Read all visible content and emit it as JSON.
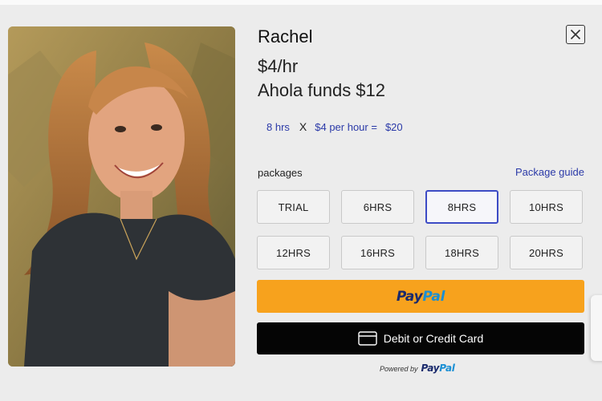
{
  "profile": {
    "name": "Rachel",
    "rate": "$4/hr",
    "funds": "Ahola funds $12"
  },
  "calculation": {
    "hours": "8 hrs",
    "multiply": "X",
    "per_hour": "$4 per hour =",
    "total": "$20"
  },
  "packages": {
    "label": "packages",
    "guide_link": "Package guide",
    "items": [
      {
        "label": "TRIAL",
        "selected": false
      },
      {
        "label": "6HRS",
        "selected": false
      },
      {
        "label": "8HRS",
        "selected": true
      },
      {
        "label": "10HRS",
        "selected": false
      },
      {
        "label": "12HRS",
        "selected": false
      },
      {
        "label": "16HRS",
        "selected": false
      },
      {
        "label": "18HRS",
        "selected": false
      },
      {
        "label": "20HRS",
        "selected": false
      }
    ]
  },
  "payment": {
    "paypal_pay": "Pay",
    "paypal_pal": "Pal",
    "card_label": "Debit or Credit Card",
    "powered_by": "Powered by",
    "powered_pay": "Pay",
    "powered_pal": "Pal"
  },
  "colors": {
    "accent_blue": "#2b3aa8",
    "selected_border": "#3d4bc5",
    "paypal_yellow": "#f7a21d",
    "card_black": "#050505"
  },
  "icons": {
    "close": "close-icon",
    "card": "credit-card-icon"
  }
}
